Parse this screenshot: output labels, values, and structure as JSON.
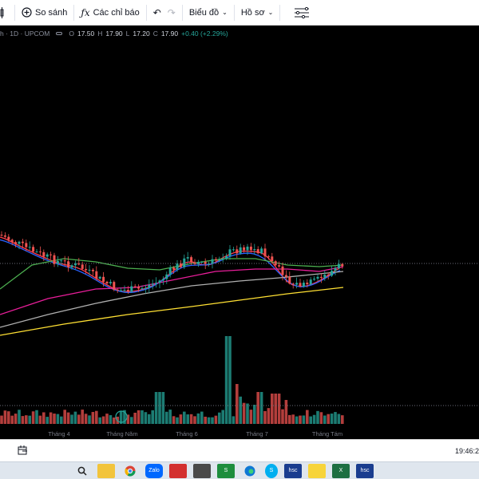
{
  "toolbar": {
    "compare_label": "So sánh",
    "indicators_label": "Các chỉ báo",
    "chart_menu_label": "Biểu đồ",
    "profile_menu_label": "Hồ sơ"
  },
  "legend": {
    "symbol": "h · 1D · UPCOM",
    "open_key": "O",
    "open": "17.50",
    "high_key": "H",
    "high": "17.90",
    "low_key": "L",
    "low": "17.20",
    "close_key": "C",
    "close": "17.90",
    "change": "+0.40 (+2.29%)"
  },
  "x_axis_labels": [
    "Tháng 4",
    "Tháng Năm",
    "Tháng 6",
    "Tháng 7",
    "Tháng Tám"
  ],
  "status_bar": {
    "time": "19:46:2"
  },
  "colors": {
    "up": "#26a69a",
    "down": "#ef5350",
    "ma_red": "#ff3b4e",
    "ma_blue": "#2962ff",
    "ma_green": "#4caf50",
    "ma_magenta": "#e91e9a",
    "ma_gray": "#b0b0b0",
    "ma_yellow": "#ffe033"
  },
  "taskbar_icons": [
    "search-icon",
    "file-explorer-icon",
    "chrome-icon",
    "zalo-icon",
    "app-red-icon",
    "calculator-icon",
    "sheets-green-icon",
    "edge-icon",
    "skype-icon",
    "hsc-icon",
    "sticky-notes-icon",
    "excel-icon",
    "hsc-icon-2"
  ]
}
